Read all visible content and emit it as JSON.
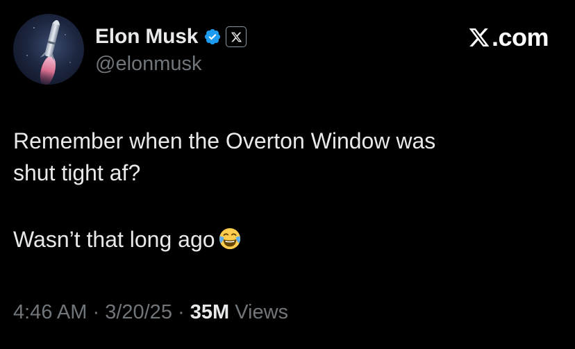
{
  "author": {
    "display_name": "Elon Musk",
    "handle": "@elonmusk",
    "avatar_icon": "rocket-avatar",
    "verified_badge_icon": "verified-check-icon",
    "affiliate_badge_icon": "x-logo-icon",
    "verified_color": "#1d9bf0"
  },
  "brand": {
    "label": ".com",
    "logo_icon": "x-logo-icon"
  },
  "tweet": {
    "line1": "Remember when the Overton Window was",
    "line2": "shut tight af?",
    "line3": "Wasn’t that long ago",
    "emoji": "face-with-tears-of-joy-icon"
  },
  "meta": {
    "time": "4:46 AM",
    "separator": " · ",
    "date": "3/20/25",
    "views_count": "35M",
    "views_label": " Views"
  },
  "colors": {
    "background": "#000000",
    "primary_text": "#e7e9ea",
    "secondary_text": "#71767b"
  }
}
